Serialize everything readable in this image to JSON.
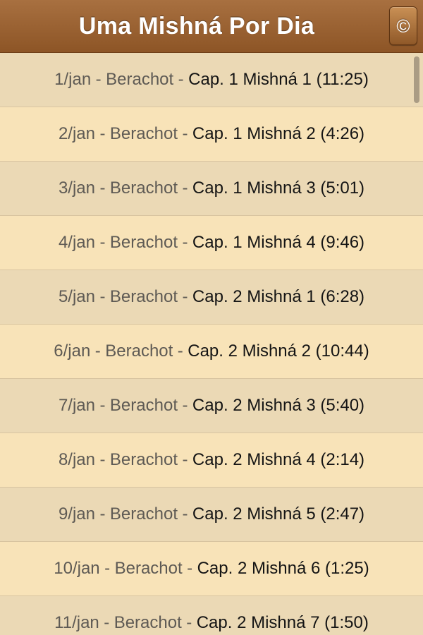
{
  "app": {
    "title": "Uma Mishná Por Dia",
    "copyright_icon": "©"
  },
  "separator": "-",
  "entries": [
    {
      "date": "1/jan",
      "tractate": "Berachot",
      "chapter": "Cap. 1 Mishná 1 (11:25)"
    },
    {
      "date": "2/jan",
      "tractate": "Berachot",
      "chapter": "Cap. 1 Mishná 2 (4:26)"
    },
    {
      "date": "3/jan",
      "tractate": "Berachot",
      "chapter": "Cap. 1 Mishná 3 (5:01)"
    },
    {
      "date": "4/jan",
      "tractate": "Berachot",
      "chapter": "Cap. 1 Mishná 4 (9:46)"
    },
    {
      "date": "5/jan",
      "tractate": "Berachot",
      "chapter": "Cap. 2 Mishná 1 (6:28)"
    },
    {
      "date": "6/jan",
      "tractate": "Berachot",
      "chapter": "Cap. 2 Mishná 2 (10:44)"
    },
    {
      "date": "7/jan",
      "tractate": "Berachot",
      "chapter": "Cap. 2 Mishná 3 (5:40)"
    },
    {
      "date": "8/jan",
      "tractate": "Berachot",
      "chapter": "Cap. 2 Mishná 4 (2:14)"
    },
    {
      "date": "9/jan",
      "tractate": "Berachot",
      "chapter": "Cap. 2 Mishná 5 (2:47)"
    },
    {
      "date": "10/jan",
      "tractate": "Berachot",
      "chapter": "Cap. 2 Mishná 6 (1:25)"
    },
    {
      "date": "11/jan",
      "tractate": "Berachot",
      "chapter": "Cap. 2 Mishná 7 (1:50)"
    }
  ],
  "colors": {
    "header": "#96602e",
    "row_odd": "#ebd9b5",
    "row_even": "#f8e3b8",
    "muted_text": "#5e5a54",
    "strong_text": "#141414"
  }
}
